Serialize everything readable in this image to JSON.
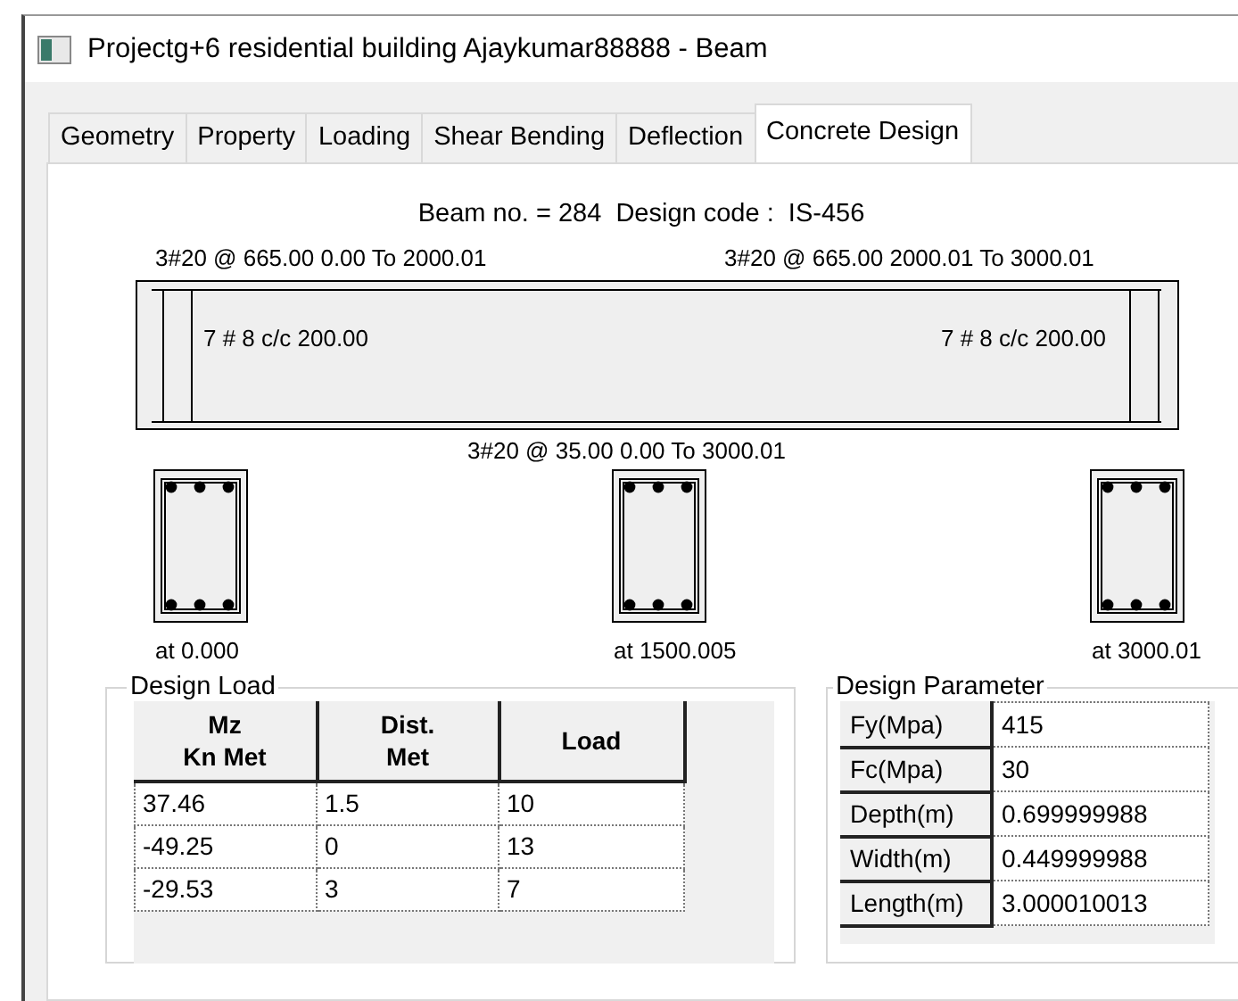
{
  "window": {
    "title": "Projectg+6 residential building Ajaykumar88888 - Beam"
  },
  "tabs": [
    {
      "label": "Geometry",
      "selected": false
    },
    {
      "label": "Property",
      "selected": false
    },
    {
      "label": "Loading",
      "selected": false
    },
    {
      "label": "Shear Bending",
      "selected": false
    },
    {
      "label": "Deflection",
      "selected": false
    },
    {
      "label": "Concrete Design",
      "selected": true
    }
  ],
  "header": "Beam no. = 284  Design code :  IS-456",
  "beam": {
    "top_left_label": "3#20 @ 665.00 0.00 To 2000.01",
    "top_right_label": "3#20 @ 665.00 2000.01 To 3000.01",
    "stirrup_left": "7 # 8 c/c 200.00",
    "stirrup_right": "7 # 8 c/c 200.00",
    "bottom_label": "3#20 @ 35.00 0.00 To 3000.01"
  },
  "sections": [
    {
      "label": "at 0.000"
    },
    {
      "label": "at 1500.005"
    },
    {
      "label": "at 3000.01"
    }
  ],
  "design_load": {
    "title": "Design Load",
    "columns": [
      "Mz\nKn Met",
      "Dist.\nMet",
      "Load"
    ],
    "rows": [
      [
        "37.46",
        "1.5",
        "10"
      ],
      [
        "-49.25",
        "0",
        "13"
      ],
      [
        "-29.53",
        "3",
        "7"
      ]
    ]
  },
  "design_parameter": {
    "title": "Design Parameter",
    "rows": [
      {
        "label": "Fy(Mpa)",
        "value": "415"
      },
      {
        "label": "Fc(Mpa)",
        "value": "30"
      },
      {
        "label": "Depth(m)",
        "value": "0.699999988"
      },
      {
        "label": "Width(m)",
        "value": "0.449999988"
      },
      {
        "label": "Length(m)",
        "value": "3.000010013"
      }
    ]
  }
}
